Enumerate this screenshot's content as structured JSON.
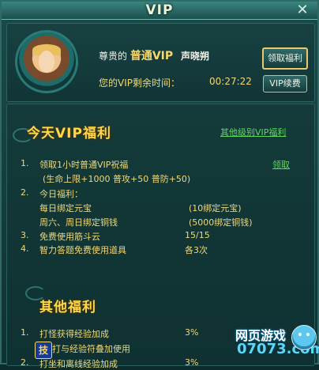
{
  "window": {
    "title": "VIP",
    "close_symbol": "✕"
  },
  "header": {
    "greeting_prefix": "尊贵的",
    "vip_level": "普通VIP",
    "player_name": "声晓朔",
    "remaining_label": "您的VIP剩余时间：",
    "remaining_time": "00:27:22",
    "claim_button": "领取福利",
    "renew_button": "VIP续费"
  },
  "today": {
    "title": "今天VIP福利",
    "other_link": "其他级别VIP福利",
    "items": [
      {
        "num": "1.",
        "label": "领取1小时普通VIP祝福",
        "sub": "(生命上限+1000 普攻+50 普防+50)",
        "action": "领取"
      },
      {
        "num": "2.",
        "label": "今日福利："
      },
      {
        "label": "每日绑定元宝",
        "value": "(10绑定元宝)"
      },
      {
        "label": "周六、周日绑定铜钱",
        "value": "(5000绑定铜钱)"
      },
      {
        "num": "3.",
        "label": "免费使用筋斗云",
        "value": "15/15"
      },
      {
        "num": "4.",
        "label": "智力答题免费使用道具",
        "value": "各3次"
      }
    ]
  },
  "other": {
    "title": "其他福利",
    "items": [
      {
        "num": "1.",
        "label": "打怪获得经验加成",
        "value": "3%"
      },
      {
        "label": "打与经验符叠加使用"
      },
      {
        "num": "2.",
        "label": "打坐和离线经验加成",
        "value": "3%"
      }
    ]
  },
  "skill_icon": "技",
  "watermark": {
    "brand": "网页游戏",
    "site": "07073.com"
  }
}
